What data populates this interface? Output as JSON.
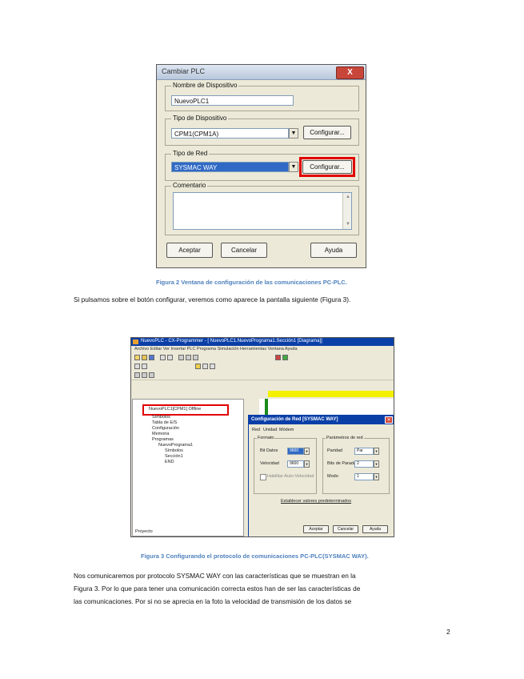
{
  "figure2": {
    "dialog_title": "Cambiar PLC",
    "close_glyph": "X",
    "device_name_label": "Nombre de Dispositivo",
    "device_name_value": "NuevoPLC1",
    "device_type_label": "Tipo de Dispositivo",
    "device_type_value": "CPM1(CPM1A)",
    "configure_label": "Configurar...",
    "network_type_label": "Tipo de Red",
    "network_type_value": "SYSMAC WAY",
    "network_configure_label": "Configurar...",
    "comment_label": "Comentario",
    "accept_label": "Aceptar",
    "cancel_label": "Cancelar",
    "help_label": "Ayuda",
    "caption": "Figura 2 Ventana de configuración de las comunicaciones PC-PLC."
  },
  "paragraph1": "Si pulsamos sobre el botón configurar, veremos como aparece la pantalla siguiente (Figura 3).",
  "figure3": {
    "window_title": "NuevoPLC - CX-Programmer - [ NuevoPLC1.NuevoPrograma1.Sección1 [Diagrama]]",
    "menu": "Archivo  Editar  Ver  Insertar  PLC  Programa  Simulación  Herramientas  Ventana  Ayuda",
    "tree_root": "NuevoPLC1[CPM1] Offline",
    "tree_items": [
      "Símbolos",
      "Tabla de E/S",
      "Configuración",
      "Memoria",
      "Programas",
      "NuevoPrograma1",
      "Símbolos",
      "Sección1",
      "END"
    ],
    "tree_tab": "Proyecto",
    "dialog_title": "Configuración de Red [SYSMAC WAY]",
    "tabs": [
      "Red",
      "Unidad",
      "Módem"
    ],
    "group_left": "Formato",
    "group_right": "Parámetros de red",
    "baud_label": "Bit Datos",
    "baud_value": "9600",
    "parity_label": "Velocidad",
    "parity_value": "9600",
    "stop_label": "Paridad",
    "stop_value": "Par",
    "data_label": "Bits de Parada",
    "data_value": "2",
    "mode_label": "Modo",
    "mode_value": "1",
    "check_label": "Habilitar Auto-Velocidad",
    "defaults_link": "Establecer valores predeterminados",
    "ok_label": "Aceptar",
    "cancel_label": "Cancelar",
    "help_label": "Ayuda",
    "caption": "Figura 3 Configurando el protocolo de comunicaciones PC-PLC(SYSMAC WAY)."
  },
  "paragraph2": [
    "Nos comunicaremos por protocolo SYSMAC WAY con las características que se muestran en la",
    "Figura 3. Por lo que para tener una comunicación correcta estos han de ser las características de",
    "las comunicaciones. Por si no se aprecia en la foto la velocidad de transmisión de los datos se"
  ],
  "page_number": "2",
  "colors": {
    "caption": "#4f81bd",
    "highlight": "#e10000",
    "title_bar": "#0b3fa8"
  }
}
